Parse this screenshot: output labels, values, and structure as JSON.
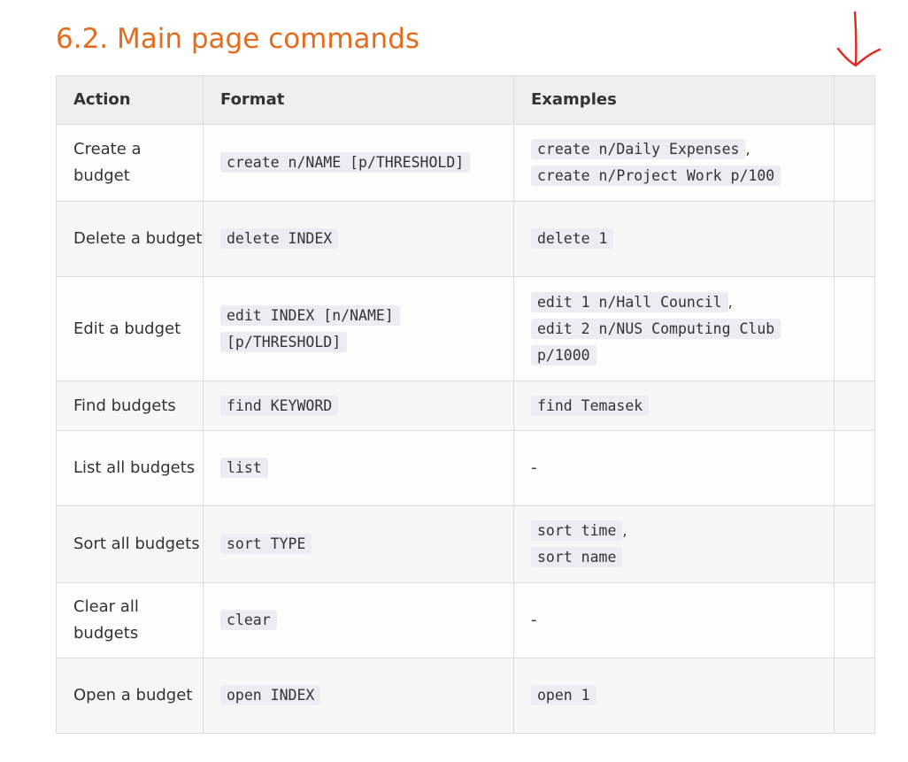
{
  "heading": "6.2. Main page commands",
  "columns": [
    "Action",
    "Format",
    "Examples",
    ""
  ],
  "rows": [
    {
      "action": "Create a budget",
      "format": "create n/NAME [p/THRESHOLD]",
      "examples": [
        "create n/Daily Expenses",
        "create n/Project Work p/100"
      ]
    },
    {
      "action": "Delete a budget",
      "format": "delete INDEX",
      "examples": [
        "delete 1"
      ]
    },
    {
      "action": "Edit a budget",
      "format": "edit INDEX [n/NAME] [p/THRESHOLD]",
      "examples": [
        "edit 1 n/Hall Council",
        "edit 2 n/NUS Computing Club p/1000"
      ]
    },
    {
      "action": "Find budgets",
      "format": "find KEYWORD",
      "examples": [
        "find Temasek"
      ]
    },
    {
      "action": "List all budgets",
      "format": "list",
      "examples": [],
      "no_example": "-"
    },
    {
      "action": "Sort all budgets",
      "format": "sort TYPE",
      "examples": [
        "sort time",
        "sort name"
      ]
    },
    {
      "action": "Clear all budgets",
      "format": "clear",
      "examples": [],
      "no_example": "-"
    },
    {
      "action": "Open a budget",
      "format": "open INDEX",
      "examples": [
        "open 1"
      ]
    }
  ],
  "colors": {
    "heading": "#e46c1f",
    "annotation": "#e0281e",
    "code_bg": "#ececf4"
  },
  "annotation_icon": "red-hand-drawn-down-arrow-icon"
}
